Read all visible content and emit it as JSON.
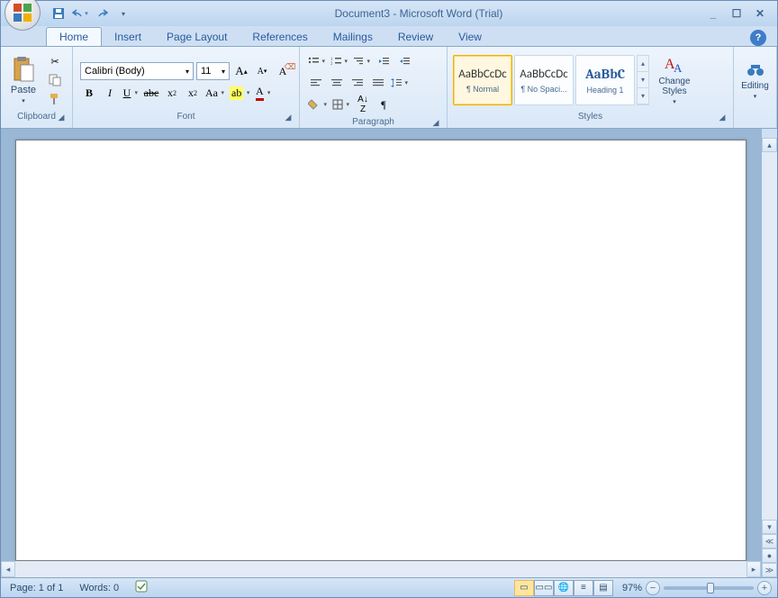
{
  "titlebar": {
    "title": "Document3 - Microsoft Word (Trial)"
  },
  "tabs": [
    "Home",
    "Insert",
    "Page Layout",
    "References",
    "Mailings",
    "Review",
    "View"
  ],
  "active_tab": 0,
  "ribbon": {
    "clipboard": {
      "label": "Clipboard",
      "paste": "Paste"
    },
    "font": {
      "label": "Font",
      "name": "Calibri (Body)",
      "size": "11"
    },
    "paragraph": {
      "label": "Paragraph"
    },
    "styles": {
      "label": "Styles",
      "change": "Change Styles",
      "items": [
        {
          "preview": "AaBbCcDc",
          "name": "¶ Normal",
          "sel": true,
          "cls": "prev"
        },
        {
          "preview": "AaBbCcDc",
          "name": "¶ No Spaci...",
          "sel": false,
          "cls": "prev"
        },
        {
          "preview": "AaBbC",
          "name": "Heading 1",
          "sel": false,
          "cls": "hprev"
        }
      ]
    },
    "editing": {
      "label": "Editing"
    }
  },
  "status": {
    "page": "Page: 1 of 1",
    "words": "Words: 0",
    "zoom": "97%"
  }
}
